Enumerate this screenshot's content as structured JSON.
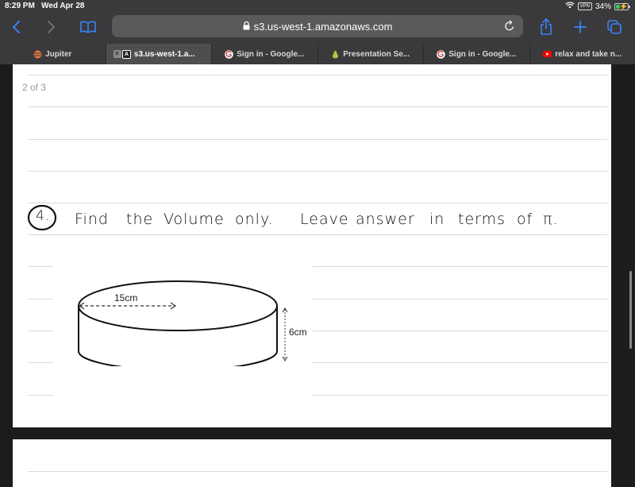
{
  "status_bar": {
    "time": "8:29 PM",
    "date": "Wed Apr 28",
    "vpn_label": "VPN",
    "battery_percent": "34%",
    "battery_level": 0.34,
    "charging": true
  },
  "toolbar": {
    "back_icon": "chevron-left-icon",
    "forward_icon": "chevron-right-icon",
    "bookmarks_icon": "book-icon",
    "url": "s3.us-west-1.amazonaws.com",
    "secure": true,
    "reload_icon": "reload-icon",
    "share_icon": "share-icon",
    "new_tab_icon": "plus-icon",
    "tabs_overview_icon": "tabs-icon",
    "accent_color": "#3b82f6"
  },
  "tabs": [
    {
      "label": "Jupiter",
      "icon": "jupiter-icon",
      "active": false
    },
    {
      "label": "s3.us-west-1.a...",
      "icon": "letter-a-icon",
      "active": true
    },
    {
      "label": "Sign in - Google...",
      "icon": "google-icon",
      "active": false
    },
    {
      "label": "Presentation Se...",
      "icon": "pear-icon",
      "active": false
    },
    {
      "label": "Sign in - Google...",
      "icon": "google-icon",
      "active": false
    },
    {
      "label": "relax and take n...",
      "icon": "youtube-icon",
      "active": false
    }
  ],
  "document": {
    "page_counter": "2 of 3",
    "question_number": "4.",
    "question_parts": [
      "Find",
      "the",
      "Volume",
      "only.",
      "Leave",
      "answer",
      "in",
      "terms",
      "of",
      "π."
    ],
    "figure": {
      "shape": "cylinder",
      "radius_label": "15cm",
      "height_label": "6cm"
    }
  }
}
